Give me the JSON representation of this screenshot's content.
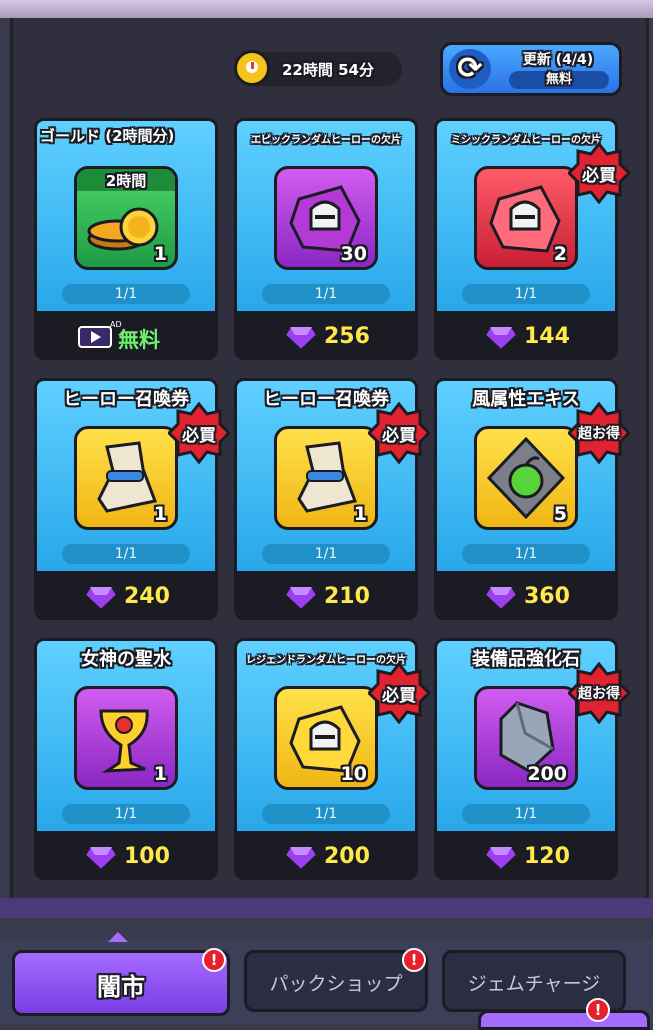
{
  "header": {
    "timer_text": "22時間 54分",
    "refresh_label": "更新 (4/4)",
    "refresh_cost": "無料"
  },
  "cards": [
    {
      "title": "ゴールド (2時間分)",
      "item_label": "2時間",
      "qty": "1",
      "stock": "1/1",
      "price": "無料",
      "price_type": "ad",
      "item_color": "green",
      "item_icon": "gold-coins-icon"
    },
    {
      "title": "エピックランダムヒーローの欠片",
      "qty": "30",
      "stock": "1/1",
      "price": "256",
      "price_type": "gem",
      "item_color": "purple",
      "item_icon": "knight-helmet-shard-icon"
    },
    {
      "title": "ミシックランダムヒーローの欠片",
      "qty": "2",
      "stock": "1/1",
      "price": "144",
      "price_type": "gem",
      "badge": "必買",
      "item_color": "red",
      "item_icon": "knight-helmet-shard-icon"
    },
    {
      "title": "ヒーロー召喚券",
      "qty": "1",
      "stock": "1/1",
      "price": "240",
      "price_type": "gem",
      "badge": "必買",
      "item_color": "yellow",
      "item_icon": "summon-scroll-icon"
    },
    {
      "title": "ヒーロー召喚券",
      "qty": "1",
      "stock": "1/1",
      "price": "210",
      "price_type": "gem",
      "badge": "必買",
      "item_color": "yellow",
      "item_icon": "summon-scroll-icon"
    },
    {
      "title": "風属性エキス",
      "qty": "5",
      "stock": "1/1",
      "price": "360",
      "price_type": "gem",
      "badge": "超お得",
      "item_color": "yellow",
      "item_icon": "wind-essence-icon"
    },
    {
      "title": "女神の聖水",
      "qty": "1",
      "stock": "1/1",
      "price": "100",
      "price_type": "gem",
      "item_color": "purple",
      "item_icon": "holy-water-icon"
    },
    {
      "title": "レジェンドランダムヒーローの欠片",
      "qty": "10",
      "stock": "1/1",
      "price": "200",
      "price_type": "gem",
      "badge": "必買",
      "item_color": "yellow",
      "item_icon": "knight-helmet-shard-icon"
    },
    {
      "title": "装備品強化石",
      "qty": "200",
      "stock": "1/1",
      "price": "120",
      "price_type": "gem",
      "badge": "超お得",
      "item_color": "purple",
      "item_icon": "enhance-stone-icon"
    }
  ],
  "ad_tag": "AD",
  "tabs": {
    "black_market": "闇市",
    "pack_shop": "パックショップ",
    "gem_charge": "ジェムチャージ",
    "notif": "!"
  },
  "colors": {
    "gem": "#9b3ff0",
    "price": "#ffe84a",
    "free": "#6ef06a",
    "badge": "#e0232f"
  }
}
